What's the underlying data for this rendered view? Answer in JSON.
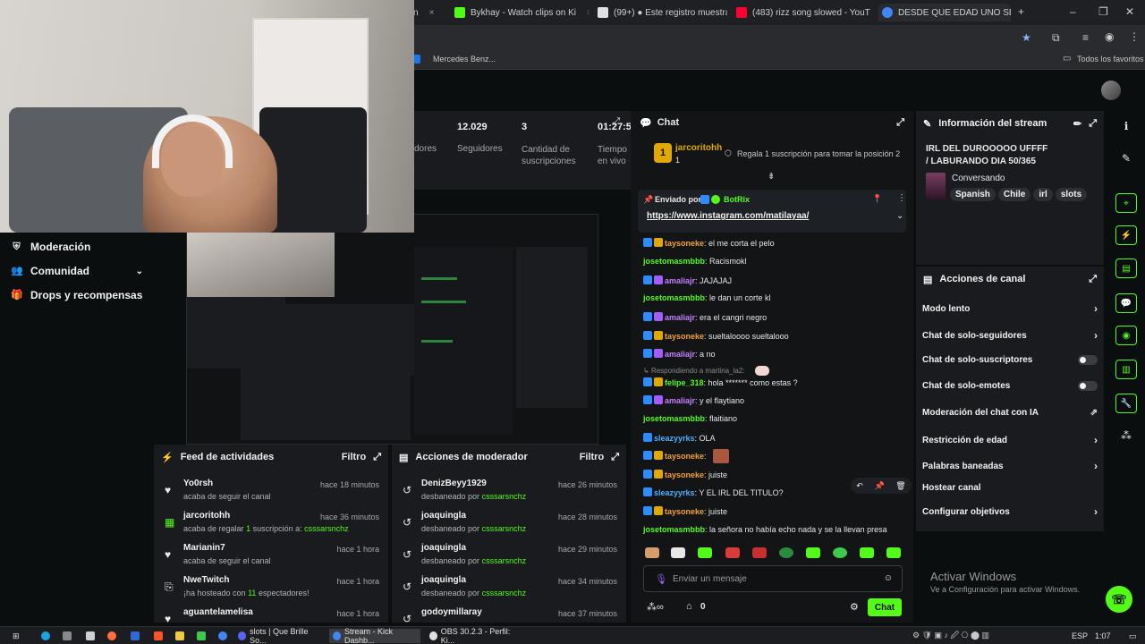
{
  "browser": {
    "tabs": [
      {
        "label": "Bykhay - Watch clips on Ki",
        "color": "#53fc18"
      },
      {
        "label": "(99+) ● Este registro muestra",
        "color": "#d0d0d0"
      },
      {
        "label": "(483) rizz song slowed - YouTu",
        "color": "#ff0033"
      },
      {
        "label": "DESDE QUE EDAD UNO SE PU",
        "color": "#4285f4"
      }
    ],
    "bookmark_left": "Mercedes Benz...",
    "bookmark_right": "Todos los favoritos"
  },
  "sidebar": {
    "items": [
      {
        "label": "Moderación"
      },
      {
        "label": "Comunidad"
      },
      {
        "label": "Drops y recompensas"
      }
    ]
  },
  "stats": {
    "followers_label": "Seguidores",
    "followers_value": "12.029",
    "followers_label_partial": "dores",
    "subs_value": "3",
    "subs_label": "Cantidad de suscripciones",
    "time_value": "01:27:5",
    "time_label": "Tiempo en vivo"
  },
  "activity_feed": {
    "title": "Feed de actividades",
    "filter": "Filtro",
    "rows": [
      {
        "name": "Yo0rsh",
        "sub": "acaba de seguir el canal",
        "time": "hace 18 minutos",
        "icon": "heart-icon"
      },
      {
        "name": "jarcoritohh",
        "sub_prefix": "acaba de regalar",
        "sub_count": "1",
        "sub_mid": "suscripción a:",
        "sub_target": "csssarsnchz",
        "time": "hace 36 minutos",
        "icon": "gift-icon"
      },
      {
        "name": "Marianin7",
        "sub": "acaba de seguir el canal",
        "time": "hace 1 hora",
        "icon": "heart-icon"
      },
      {
        "name": "NweTwitch",
        "sub_prefix": "¡ha hosteado con",
        "sub_count": "11",
        "sub_mid": "espectadores!",
        "time": "hace 1 hora",
        "icon": "host-icon"
      },
      {
        "name": "aguantelamelisa",
        "sub": "",
        "time": "hace 1 hora",
        "icon": "heart-icon"
      }
    ]
  },
  "mod_actions": {
    "title": "Acciones de moderador",
    "filter": "Filtro",
    "rows": [
      {
        "name": "DenizBeyy1929",
        "sub": "desbaneado por",
        "by": "csssarsnchz",
        "time": "hace 26 minutos"
      },
      {
        "name": "joaquingla",
        "sub": "desbaneado por",
        "by": "csssarsnchz",
        "time": "hace 28 minutos"
      },
      {
        "name": "joaquingla",
        "sub": "desbaneado por",
        "by": "csssarsnchz",
        "time": "hace 29 minutos"
      },
      {
        "name": "joaquingla",
        "sub": "desbaneado por",
        "by": "csssarsnchz",
        "time": "hace 34 minutos"
      },
      {
        "name": "godoymillaray",
        "sub": "",
        "by": "",
        "time": "hace 37 minutos"
      }
    ]
  },
  "chat": {
    "title": "Chat",
    "top_gifter_rank": "1",
    "top_gifter_name": "jarcoritohh",
    "top_gifter_count": "1",
    "gift_prompt": "Regala 1 suscripción para tomar la posición 2",
    "pinned_prefix": "Enviado por",
    "pinned_user": "BotRix",
    "pinned_link": "https://www.instagram.com/matilayaa/",
    "reply_note": "Respondiendo a martina_la2:",
    "messages": [
      {
        "user": "taysoneke",
        "text": ": el me corta el pelo",
        "color": "#f2a03d",
        "badges": [
          "b-blue",
          "b-gold"
        ]
      },
      {
        "user": "josetomasmbbb",
        "text": ": Racismokl",
        "color": "#53fc18",
        "badges": []
      },
      {
        "user": "amaliajr",
        "text": ": JAJAJAJ",
        "color": "#c77dff",
        "badges": [
          "b-blue",
          "b-purple"
        ]
      },
      {
        "user": "josetomasmbbb",
        "text": ": le dan un corte kl",
        "color": "#53fc18",
        "badges": []
      },
      {
        "user": "amaliajr",
        "text": ": era el cangri negro",
        "color": "#c77dff",
        "badges": [
          "b-blue",
          "b-purple"
        ]
      },
      {
        "user": "taysoneke",
        "text": ": sueltaloooo sueltalooo",
        "color": "#f2a03d",
        "badges": [
          "b-blue",
          "b-gold"
        ]
      },
      {
        "user": "amaliajr",
        "text": ": a no",
        "color": "#c77dff",
        "badges": [
          "b-blue",
          "b-purple"
        ]
      },
      {
        "user": "felipe_318",
        "text": ": hola ******* como estas ?",
        "color": "#53fc18",
        "badges": [
          "b-blue",
          "b-gold"
        ]
      },
      {
        "user": "amaliajr",
        "text": ": y el flaytiano",
        "color": "#c77dff",
        "badges": [
          "b-blue",
          "b-purple"
        ]
      },
      {
        "user": "josetomasmbbb",
        "text": ": flaitiano",
        "color": "#53fc18",
        "badges": []
      },
      {
        "user": "sleazyyrks",
        "text": ": OLA",
        "color": "#4fb0ff",
        "badges": [
          "b-blue"
        ]
      },
      {
        "user": "taysoneke",
        "text": ":",
        "color": "#f2a03d",
        "badges": [
          "b-blue",
          "b-gold"
        ]
      },
      {
        "user": "taysoneke",
        "text": ": juiste",
        "color": "#f2a03d",
        "badges": [
          "b-blue",
          "b-gold"
        ]
      },
      {
        "user": "sleazyyrks",
        "text": ": Y EL IRL DEL TITULO?",
        "color": "#4fb0ff",
        "badges": [
          "b-blue"
        ]
      },
      {
        "user": "taysoneke",
        "text": ": juiste",
        "color": "#f2a03d",
        "badges": [
          "b-blue",
          "b-gold"
        ]
      },
      {
        "user": "josetomasmbbb",
        "text": ": la señora no había echo nada y se la llevan presa",
        "color": "#53fc18",
        "badges": []
      }
    ],
    "input_placeholder": "Enviar un mensaje",
    "points": "0",
    "send_label": "Chat"
  },
  "stream_info": {
    "title": "Información del stream",
    "stream_title": "IRL DEL DUROOOOO UFFFF / LABURANDO DIA 50/365",
    "category": "Conversando",
    "tags": [
      "Spanish",
      "Chile",
      "irl",
      "slots"
    ]
  },
  "channel_actions": {
    "title": "Acciones de canal",
    "rows": [
      {
        "label": "Modo lento",
        "control": "chevron"
      },
      {
        "label": "Chat de solo-seguidores",
        "control": "chevron"
      },
      {
        "label": "Chat de solo-suscriptores",
        "control": "toggle"
      },
      {
        "label": "Chat de solo-emotes",
        "control": "toggle"
      },
      {
        "label": "Moderación del chat con IA",
        "control": "external"
      },
      {
        "label": "Restricción de edad",
        "control": "chevron"
      },
      {
        "label": "Palabras baneadas",
        "control": "chevron"
      },
      {
        "label": "Hostear canal",
        "control": "none"
      },
      {
        "label": "Configurar objetivos",
        "control": "chevron"
      }
    ]
  },
  "watermark": {
    "title": "Activar Windows",
    "subtitle": "Ve a Configuración para activar Windows."
  },
  "taskbar": {
    "items": [
      {
        "label": "slots | Que Brille So...",
        "color": "#5865f2"
      },
      {
        "label": "Stream - Kick Dashb...",
        "color": "#4285f4"
      },
      {
        "label": "OBS 30.2.3 - Perfil: Ki...",
        "color": "#e0e0e0"
      }
    ],
    "lang": "ESP",
    "time": "1:07"
  }
}
